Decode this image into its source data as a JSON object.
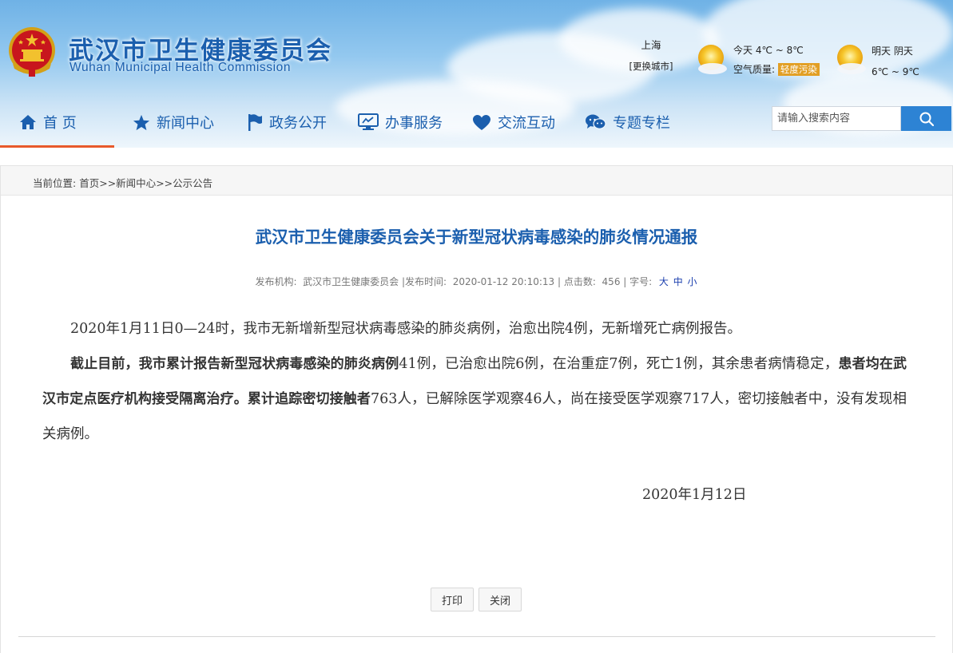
{
  "header": {
    "title_cn": "武汉市卫生健康委员会",
    "title_en": "Wuhan Municipal Health Commission",
    "city": "上海",
    "change_city": "[更换城市]",
    "today_label": "今天",
    "today_temp": "4℃ ~ 8℃",
    "air_label": "空气质量:",
    "air_value": "轻度污染",
    "tomorrow_label": "明天",
    "tomorrow_weather": "阴天",
    "tomorrow_temp": "6℃ ~ 9℃"
  },
  "nav": {
    "items": [
      {
        "label": "首 页",
        "icon": "home-icon"
      },
      {
        "label": "新闻中心",
        "icon": "star-icon"
      },
      {
        "label": "政务公开",
        "icon": "flag-icon"
      },
      {
        "label": "办事服务",
        "icon": "monitor-icon"
      },
      {
        "label": "交流互动",
        "icon": "heart-icon"
      },
      {
        "label": "专题专栏",
        "icon": "chat-icon"
      }
    ],
    "search_placeholder": "请输入搜索内容"
  },
  "breadcrumb": {
    "prefix": "当前位置:",
    "items": [
      "首页",
      "新闻中心",
      "公示公告"
    ],
    "separator": ">>"
  },
  "article": {
    "title": "武汉市卫生健康委员会关于新型冠状病毒感染的肺炎情况通报",
    "publisher_label": "发布机构:",
    "publisher": "武汉市卫生健康委员会",
    "time_label": "发布时间:",
    "time": "2020-01-12 20:10:13",
    "clicks_label": "点击数:",
    "clicks": "456",
    "fontsize_label": "字号:",
    "font_sizes": [
      "大",
      "中",
      "小"
    ],
    "p1": "2020年1月11日0—24时，我市无新增新型冠状病毒感染的肺炎病例，治愈出院4例，无新增死亡病例报告。",
    "p2_bold1": "截止目前，我市累计报告新型冠状病毒感染的肺炎病例",
    "p2_a": "41例，已治愈出院6例，在治重症7例，死亡1例，其余患者病情稳定，",
    "p2_bold2": "患者均在武汉市定点医疗机构接受隔离治疗。累计追踪密切接触者",
    "p2_b": "763人，已解除医学观察46人，尚在接受医学观察717人，密切接触者中，没有发现相关病例。",
    "date": "2020年1月12日",
    "print_label": "打印",
    "close_label": "关闭"
  },
  "colors": {
    "brand_blue": "#1b5fae",
    "nav_active": "#e85a2b",
    "air_badge": "#e29f24",
    "search_btn": "#2d83d4"
  }
}
